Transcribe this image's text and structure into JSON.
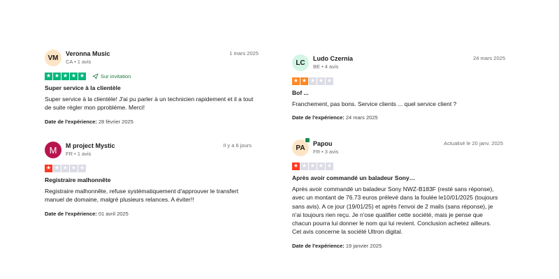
{
  "reviews": [
    {
      "initials": "VM",
      "avatar_color": "#fde4c4",
      "name": "Veronna Music",
      "meta": "CA • 1 avis",
      "date": "1 mars 2025",
      "rating": 5,
      "star_color": "#00b67a",
      "invitation": "Sur invitation",
      "title": "Super service à la clientèle",
      "body": "Super service à la clientèle! J'ai pu parler à un technicien rapidement et il a tout de suite régler mon pprobléme. Merci!",
      "experience_label": "Date de l'expérience:",
      "experience_date": "28 février 2025"
    },
    {
      "initials": "M",
      "avatar_color": "#b8154f",
      "name": "M project Mystic",
      "meta": "FR • 1 avis",
      "date": "Il y a 6 jours",
      "rating": 1,
      "star_color": "#ff3722",
      "title": "Registraire malhonnête",
      "body": "Registraire malhonnête, refuse systématiquement d'approuver le transfert manuel de domaine, malgré plusieurs relances. A éviter!!",
      "experience_label": "Date de l'expérience:",
      "experience_date": "01 avril 2025"
    },
    {
      "initials": "LC",
      "avatar_color": "#d3f5e6",
      "name": "Ludo Czernia",
      "meta": "BE • 4 avis",
      "date": "24 mars 2025",
      "rating": 2,
      "star_color": "#ff8622",
      "title": "Bof ...",
      "body": "Franchement, pas bons. Service clients ... quel service client ?",
      "experience_label": "Date de l'expérience:",
      "experience_date": "24 mars 2025"
    },
    {
      "initials": "PA",
      "avatar_color": "#fde4c4",
      "name": "Papou",
      "meta": "FR • 3 avis",
      "date": "Actualisé le 20 janv. 2025",
      "rating": 1,
      "star_color": "#ff3722",
      "title": "Après avoir commandé un baladeur Sony…",
      "body": "Après avoir commandé un baladeur Sony NWZ-B183F (resté sans réponse), avec un montant de 76.73 euros prélevé dans la foulée le10/01/2025 (toujours sans avis). A ce jour (19/01/25) et après l'envoi de 2 mails (sans réponse), je n'ai toujours rien reçu. Je n'ose qualifier cette société, mais je pense que chacun pourra lui donner le nom qui lui revient. Conclusion achetez ailleurs. Cet avis concerne la société Ultron digital.",
      "experience_label": "Date de l'expérience:",
      "experience_date": "19 janvier 2025"
    }
  ]
}
